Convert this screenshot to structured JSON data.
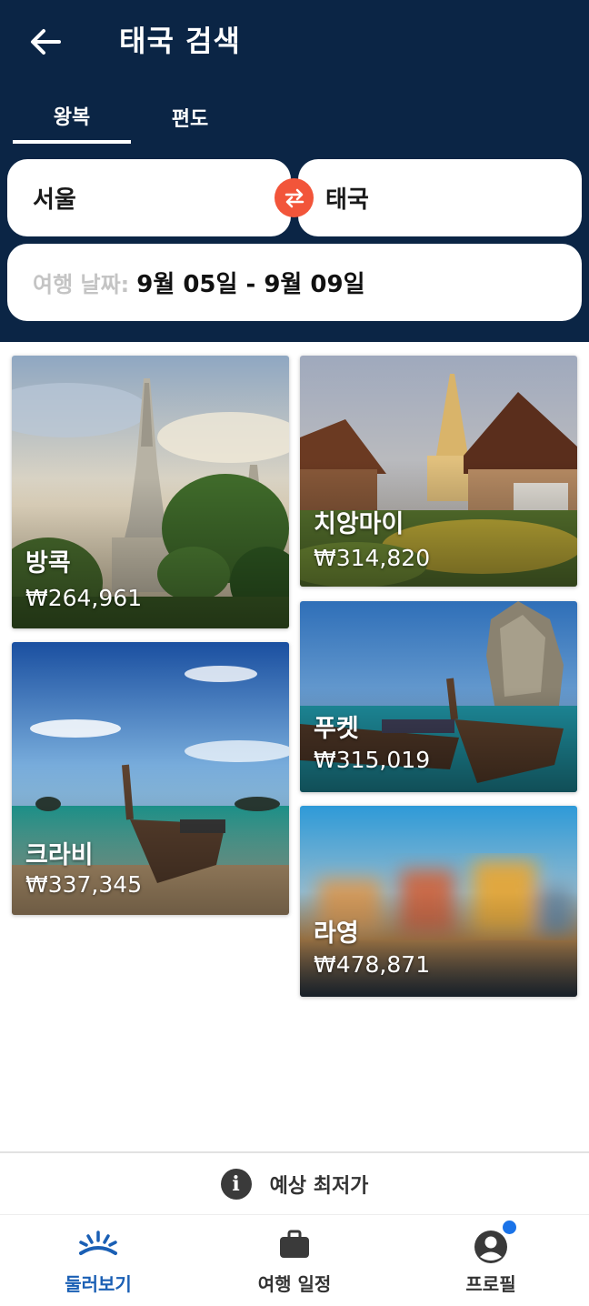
{
  "header": {
    "title": "태국 검색",
    "tabs": [
      "왕복",
      "편도"
    ],
    "origin": "서울",
    "destination": "태국",
    "date_label": "여행 날짜:",
    "date_value": "9월 05일 - 9월 09일"
  },
  "destinations": [
    {
      "city": "방콕",
      "price": "₩264,961"
    },
    {
      "city": "치앙마이",
      "price": "₩314,820"
    },
    {
      "city": "크라비",
      "price": "₩337,345"
    },
    {
      "city": "푸켓",
      "price": "₩315,019"
    },
    {
      "city": "라영",
      "price": "₩478,871"
    }
  ],
  "lowest_price_bar": {
    "label": "예상 최저가",
    "icon": "info-icon"
  },
  "bottom_nav": [
    {
      "label": "둘러보기",
      "icon": "sunrise-icon",
      "active": true
    },
    {
      "label": "여행 일정",
      "icon": "briefcase-icon",
      "active": false
    },
    {
      "label": "프로필",
      "icon": "profile-icon",
      "active": false
    }
  ],
  "colors": {
    "header_bg": "#0b2545",
    "swap_button": "#f2553a",
    "active_nav": "#1a5fb4",
    "notification_dot": "#1a73e8"
  }
}
